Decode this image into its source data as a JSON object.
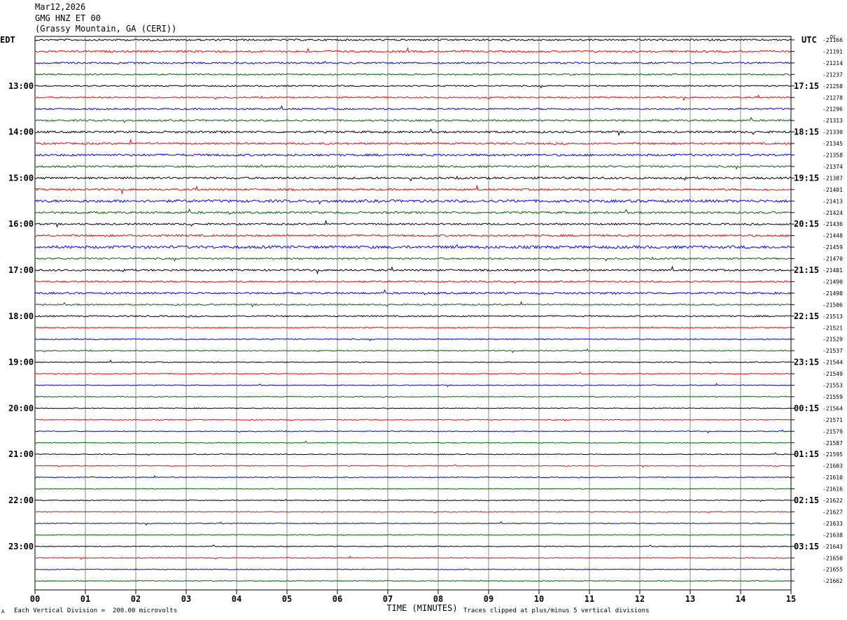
{
  "header": {
    "date": "Mar12,2026",
    "station": "GMG HNZ ET 00",
    "location": "(Grassy Mountain, GA (CERI))"
  },
  "left_tz": "EDT",
  "right_tz": "UTC",
  "dc_label": "DC",
  "footer": {
    "scale_note": "Each Vertical Division =  200.00 microvolts",
    "clip_note": "Traces clipped at plus/minus 5 vertical divisions",
    "corner_mark": "A"
  },
  "chart_data": {
    "type": "line",
    "title": "GMG HNZ ET 00",
    "xlabel": "TIME (MINUTES)",
    "ylabel": "",
    "xlim": [
      0,
      15
    ],
    "x_ticks": [
      "00",
      "01",
      "02",
      "03",
      "04",
      "05",
      "06",
      "07",
      "08",
      "09",
      "10",
      "11",
      "12",
      "13",
      "14",
      "15"
    ],
    "trace_colors": [
      "#000000",
      "#ff0000",
      "#0000ff",
      "#006400"
    ],
    "left_hour_labels": [
      "13:00",
      "14:00",
      "15:00",
      "16:00",
      "17:00",
      "18:00",
      "19:00",
      "20:00",
      "21:00",
      "22:00",
      "23:00"
    ],
    "right_hour_labels": [
      "17:15",
      "18:15",
      "19:15",
      "20:15",
      "21:15",
      "22:15",
      "23:15",
      "00:15",
      "01:15",
      "02:15",
      "03:15"
    ],
    "dc_offsets": [
      "-21166",
      "-21191",
      "-21214",
      "-21237",
      "-21258",
      "-21278",
      "-21296",
      "-21313",
      "-21330",
      "-21345",
      "-21358",
      "-21374",
      "-21387",
      "-21401",
      "-21413",
      "-21424",
      "-21436",
      "-21448",
      "-21459",
      "-21470",
      "-21481",
      "-21490",
      "-21498",
      "-21506",
      "-21513",
      "-21521",
      "-21529",
      "-21537",
      "-21544",
      "-21549",
      "-21553",
      "-21559",
      "-21564",
      "-21571",
      "-21579",
      "-21587",
      "-21595",
      "-21603",
      "-21610",
      "-21616",
      "-21622",
      "-21627",
      "-21633",
      "-21638",
      "-21643",
      "-21650",
      "-21655",
      "-21662"
    ],
    "trace_noise_level": [
      1.2,
      1.3,
      1.2,
      1.0,
      1.0,
      1.0,
      1.1,
      1.2,
      1.4,
      1.3,
      1.5,
      1.3,
      1.5,
      1.4,
      1.8,
      1.4,
      1.2,
      1.4,
      1.9,
      1.2,
      1.3,
      1.1,
      1.3,
      1.0,
      1.0,
      0.8,
      0.8,
      0.7,
      0.7,
      0.6,
      0.6,
      0.6,
      0.6,
      0.6,
      0.6,
      0.6,
      0.6,
      0.6,
      0.6,
      0.6,
      0.6,
      0.6,
      0.6,
      0.6,
      0.6,
      0.6,
      0.6,
      0.6
    ]
  }
}
